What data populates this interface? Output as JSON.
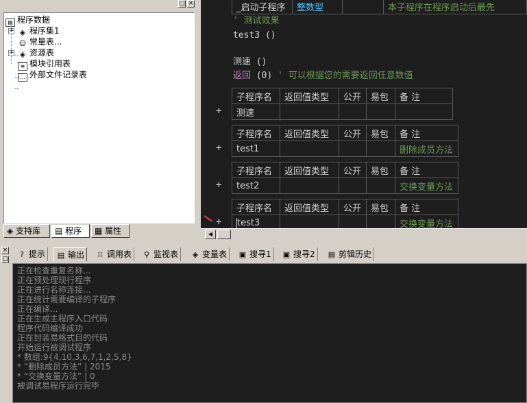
{
  "tree": {
    "root": "程序数据",
    "items": [
      {
        "label": "程序集1",
        "icon": "assembly-icon",
        "expandable": true
      },
      {
        "label": "常量表...",
        "icon": "constants-icon",
        "expandable": false
      },
      {
        "label": "资源表",
        "icon": "resources-icon",
        "expandable": true
      },
      {
        "label": "模块引用表",
        "icon": "module-ref-icon",
        "expandable": false
      },
      {
        "label": "外部文件记录表",
        "icon": "external-file-icon",
        "expandable": false
      }
    ]
  },
  "left_tabs": [
    "支持库",
    "程序",
    "属性"
  ],
  "editor": {
    "top_row": {
      "name": "_启动子程序",
      "type": "整数型",
      "note": "本子程序在程序启动后最先"
    },
    "lines": {
      "comment1": "' 测试效果",
      "call_test3": "test3 ()",
      "call_cesu": "测速 ()",
      "return_kw": "返回",
      "return_args": " (0)",
      "return_comment": "' 可以根据您的需要返回任意数值"
    },
    "table_headers": [
      "子程序名",
      "返回值类型",
      "公开",
      "易包",
      "备 注"
    ],
    "subs": [
      {
        "name": "测速",
        "note": ""
      },
      {
        "name": "test1",
        "note": "删除成员方法"
      },
      {
        "name": "test2",
        "note": "交换变量方法"
      },
      {
        "name": "test3",
        "note": "交换变量方法"
      }
    ],
    "plus": "+"
  },
  "bottom_tabs": [
    {
      "label": "提示",
      "icon": "hint-icon"
    },
    {
      "label": "输出",
      "icon": "output-icon"
    },
    {
      "label": "调用表",
      "icon": "call-table-icon"
    },
    {
      "label": "监视表",
      "icon": "watch-icon"
    },
    {
      "label": "变量表",
      "icon": "variables-icon"
    },
    {
      "label": "搜寻1",
      "icon": "search1-icon"
    },
    {
      "label": "搜寻2",
      "icon": "search2-icon"
    },
    {
      "label": "剪辑历史",
      "icon": "clipboard-history-icon"
    }
  ],
  "output_lines": [
    "正在检查重复名称...",
    "正在预处理现行程序",
    "正在进行名称连接...",
    "正在统计需要编译的子程序",
    "正在编译...",
    "正在生成主程序入口代码",
    "程序代码编译成功",
    "正在封装易格式目的代码",
    "开始运行被调试程序",
    "* 数组:9{4,10,3,6,7,1,2,5,8}",
    "* “删除成员方法” | 2015",
    "* “交换变量方法” | 0",
    "被调试易程序运行完毕"
  ]
}
